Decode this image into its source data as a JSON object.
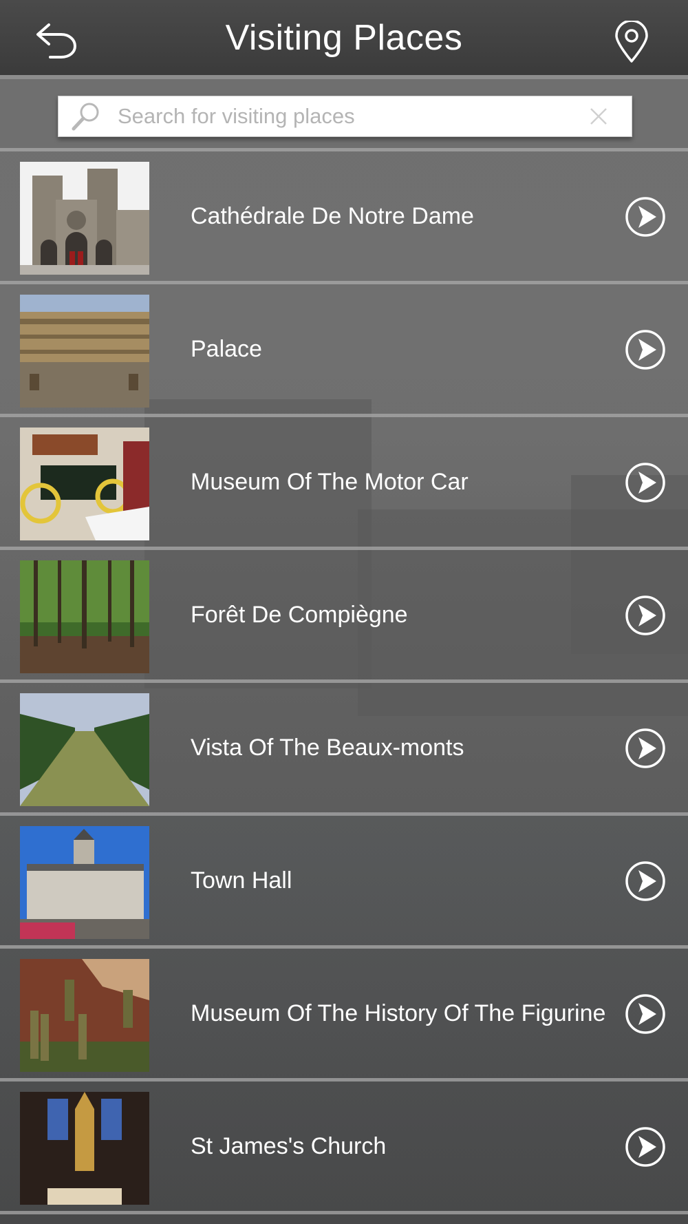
{
  "header": {
    "title": "Visiting Places",
    "back_icon": "back-arrow-icon",
    "map_icon": "map-pin-icon"
  },
  "search": {
    "placeholder": "Search for visiting places",
    "value": "",
    "search_icon": "magnifier-icon",
    "clear_icon": "clear-x-icon"
  },
  "places": [
    {
      "name": "Cathédrale De Notre Dame",
      "thumb": "cathedral"
    },
    {
      "name": "Palace",
      "thumb": "palace"
    },
    {
      "name": "Museum Of The Motor Car",
      "thumb": "car"
    },
    {
      "name": "Forêt De Compiègne",
      "thumb": "forest"
    },
    {
      "name": "Vista Of The Beaux-monts",
      "thumb": "vista"
    },
    {
      "name": "Town Hall",
      "thumb": "townhall"
    },
    {
      "name": "Museum Of The History Of The Figurine",
      "thumb": "figurine"
    },
    {
      "name": "St James's Church",
      "thumb": "church"
    }
  ],
  "colors": {
    "topbar": "#3f3f3f",
    "row_divider": "#aaaaaa",
    "text": "#ffffff"
  }
}
